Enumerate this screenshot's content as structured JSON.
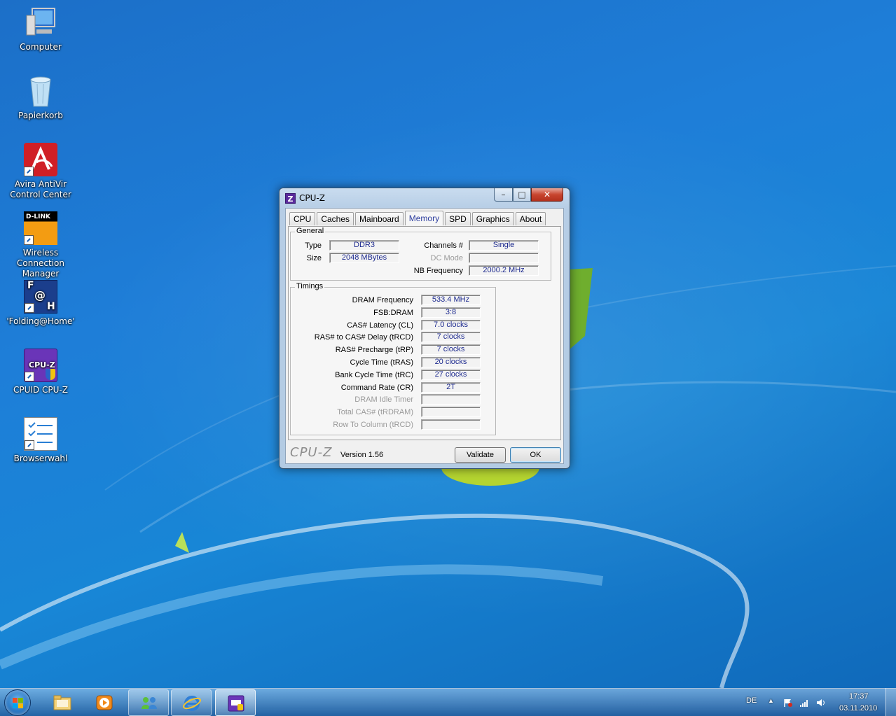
{
  "desktop": {
    "icons": [
      {
        "label": "Computer"
      },
      {
        "label": "Papierkorb"
      },
      {
        "label": "Avira AntiVir Control Center"
      },
      {
        "label": "Wireless Connection Manager",
        "logo_text": "D-LINK"
      },
      {
        "label": "'Folding@Home'",
        "logo_text_top": "F",
        "logo_text_mid": "@",
        "logo_text_bot": "H"
      },
      {
        "label": "CPUID CPU-Z",
        "logo_text": "CPU-Z"
      },
      {
        "label": "Browserwahl"
      }
    ]
  },
  "window": {
    "title": "CPU-Z",
    "app_icon_text": "Z",
    "buttons": {
      "minimize": "–",
      "maximize": "□",
      "close": "✕"
    },
    "tabs": [
      {
        "label": "CPU"
      },
      {
        "label": "Caches"
      },
      {
        "label": "Mainboard"
      },
      {
        "label": "Memory",
        "active": true
      },
      {
        "label": "SPD"
      },
      {
        "label": "Graphics"
      },
      {
        "label": "About"
      }
    ],
    "general": {
      "legend": "General",
      "type_label": "Type",
      "type_value": "DDR3",
      "size_label": "Size",
      "size_value": "2048 MBytes",
      "channels_label": "Channels #",
      "channels_value": "Single",
      "dcmode_label": "DC Mode",
      "dcmode_value": "",
      "nbfreq_label": "NB Frequency",
      "nbfreq_value": "2000.2 MHz"
    },
    "timings": {
      "legend": "Timings",
      "rows": [
        {
          "label": "DRAM Frequency",
          "value": "533.4 MHz",
          "disabled": false
        },
        {
          "label": "FSB:DRAM",
          "value": "3:8",
          "disabled": false
        },
        {
          "label": "CAS# Latency (CL)",
          "value": "7.0 clocks",
          "disabled": false
        },
        {
          "label": "RAS# to CAS# Delay (tRCD)",
          "value": "7 clocks",
          "disabled": false
        },
        {
          "label": "RAS# Precharge (tRP)",
          "value": "7 clocks",
          "disabled": false
        },
        {
          "label": "Cycle Time (tRAS)",
          "value": "20 clocks",
          "disabled": false
        },
        {
          "label": "Bank Cycle Time (tRC)",
          "value": "27 clocks",
          "disabled": false
        },
        {
          "label": "Command Rate (CR)",
          "value": "2T",
          "disabled": false
        },
        {
          "label": "DRAM Idle Timer",
          "value": "",
          "disabled": true
        },
        {
          "label": "Total CAS# (tRDRAM)",
          "value": "",
          "disabled": true
        },
        {
          "label": "Row To Column (tRCD)",
          "value": "",
          "disabled": true
        }
      ]
    },
    "footer": {
      "logo": "CPU-Z",
      "version": "Version 1.56",
      "validate_label": "Validate",
      "ok_label": "OK"
    }
  },
  "taskbar": {
    "language": "DE",
    "time": "17:37",
    "date": "03.11.2010"
  }
}
